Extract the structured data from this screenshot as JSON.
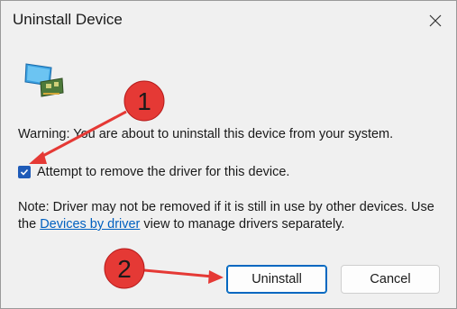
{
  "window": {
    "title": "Uninstall Device"
  },
  "content": {
    "warning": "Warning: You are about to uninstall this device from your system.",
    "checkbox": {
      "label": "Attempt to remove the driver for this device.",
      "checked": true
    },
    "note": {
      "part1": "Note: Driver may not be removed if it is still in use by other devices. Use the ",
      "link": "Devices by driver",
      "part2": " view to manage drivers separately."
    }
  },
  "buttons": {
    "uninstall": "Uninstall",
    "cancel": "Cancel"
  },
  "annotations": {
    "marker1": "1",
    "marker2": "2",
    "color": "#e53935"
  },
  "colors": {
    "accent": "#1f5bb8",
    "link": "#0060c0"
  },
  "icons": {
    "device": "network-adapter-icon",
    "close": "close-icon",
    "check": "checkmark-icon"
  }
}
